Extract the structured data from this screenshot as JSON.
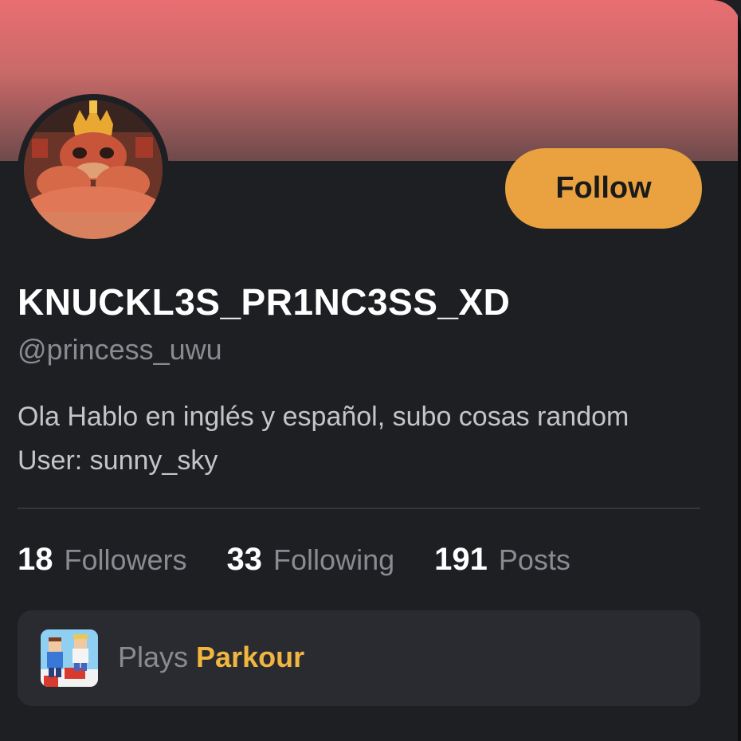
{
  "profile": {
    "display_name": "KNUCKL3S_PR1NC3SS_XD",
    "username": "@princess_uwu",
    "bio": "Ola Hablo en inglés y español, subo cosas random User: sunny_sky",
    "follow_label": "Follow"
  },
  "stats": [
    {
      "count": "18",
      "label": "Followers"
    },
    {
      "count": "33",
      "label": "Following"
    },
    {
      "count": "191",
      "label": "Posts"
    }
  ],
  "plays": {
    "prefix": "Plays",
    "game": "Parkour"
  },
  "colors": {
    "banner_top": "#e96e72",
    "background": "#1e1f23",
    "follow_button": "#e9a23f",
    "game_link": "#f0b640"
  },
  "icons": {
    "avatar": "profile-avatar-image",
    "game": "parkour-game-thumbnail"
  }
}
